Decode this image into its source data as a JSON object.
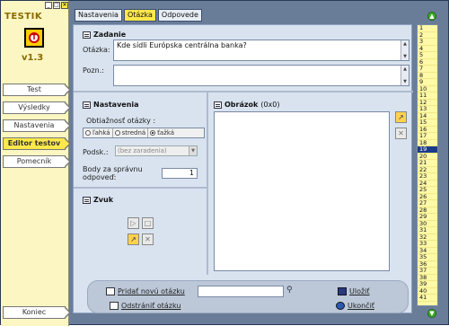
{
  "sidebar": {
    "app_title": "TESTIK",
    "logo_letter": "T",
    "version": "v1.3",
    "window_min": "_",
    "window_max": "□",
    "window_close": "✕",
    "items": [
      {
        "label": "Test"
      },
      {
        "label": "Výsledky"
      },
      {
        "label": "Nastavenia"
      },
      {
        "label": "Editor testov"
      },
      {
        "label": "Pomecník"
      }
    ],
    "exit_label": "Koniec"
  },
  "tabs": [
    {
      "label": "Nastavenia"
    },
    {
      "label": "Otázka"
    },
    {
      "label": "Odpovede"
    }
  ],
  "zadanie": {
    "title": "Zadanie",
    "question_label": "Otázka:",
    "question_value": "Kde sídli Európska centrálna banka?",
    "note_label": "Pozn.:",
    "note_value": ""
  },
  "nastavenia": {
    "title": "Nastavenia",
    "difficulty_label": "Obtiažnosť otázky :",
    "difficulty_options": [
      "ľahká",
      "stredná",
      "ťažká"
    ],
    "difficulty_selected": "ťažká",
    "subcategory_label": "Podsk.:",
    "subcategory_value": "(bez zaradenia)",
    "points_label": "Body za správnu odpoveď:",
    "points_value": "1"
  },
  "zvuk": {
    "title": "Zvuk"
  },
  "obrazok": {
    "title": "Obrázok",
    "dims": "(0x0)"
  },
  "bottom": {
    "add_label": "Pridať novú otázku",
    "remove_label": "Odstrániť otázku",
    "search_placeholder": "",
    "save_label": "Uložiť",
    "exit_label": "Ukončiť"
  },
  "question_numbers": [
    "1",
    "2",
    "3",
    "4",
    "5",
    "6",
    "7",
    "8",
    "9",
    "10",
    "11",
    "12",
    "13",
    "14",
    "15",
    "16",
    "17",
    "18",
    "19",
    "20",
    "21",
    "22",
    "23",
    "24",
    "25",
    "26",
    "27",
    "28",
    "29",
    "30",
    "31",
    "32",
    "33",
    "34",
    "35",
    "36",
    "37",
    "38",
    "39",
    "40",
    "41"
  ],
  "selected_question": "19",
  "colors": {
    "accent": "#ffe84a",
    "panel": "#d9e3ef",
    "selected": "#1b3a8a"
  }
}
